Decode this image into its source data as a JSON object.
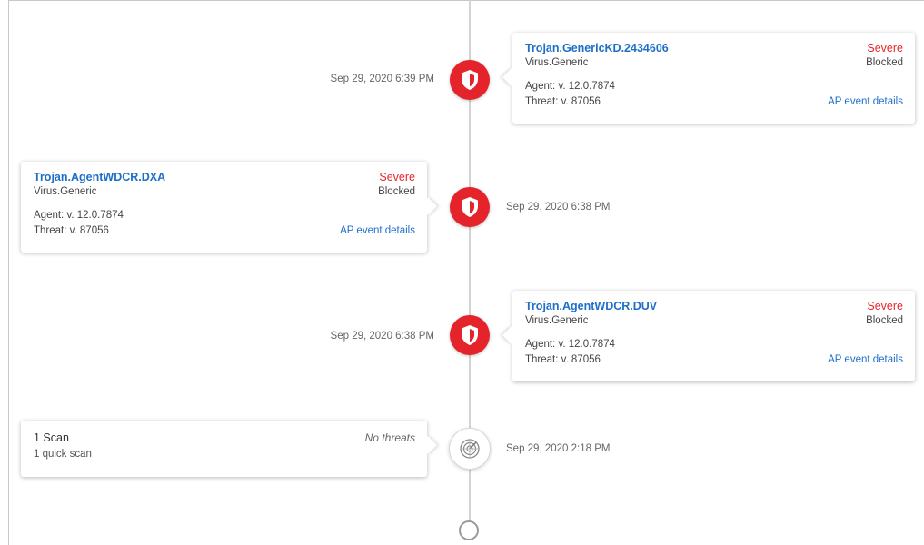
{
  "events": [
    {
      "threat_name": "Trojan.GenericKD.2434606",
      "severity": "Severe",
      "category": "Virus.Generic",
      "status": "Blocked",
      "agent": "Agent: v. 12.0.7874",
      "threat_version": "Threat: v. 87056",
      "details_label": "AP event details",
      "timestamp": "Sep 29, 2020 6:39 PM",
      "side": "right"
    },
    {
      "threat_name": "Trojan.AgentWDCR.DXA",
      "severity": "Severe",
      "category": "Virus.Generic",
      "status": "Blocked",
      "agent": "Agent: v. 12.0.7874",
      "threat_version": "Threat: v. 87056",
      "details_label": "AP event details",
      "timestamp": "Sep 29, 2020 6:38 PM",
      "side": "left"
    },
    {
      "threat_name": "Trojan.AgentWDCR.DUV",
      "severity": "Severe",
      "category": "Virus.Generic",
      "status": "Blocked",
      "agent": "Agent: v. 12.0.7874",
      "threat_version": "Threat: v. 87056",
      "details_label": "AP event details",
      "timestamp": "Sep 29, 2020 6:38 PM",
      "side": "right"
    }
  ],
  "scan_event": {
    "title": "1 Scan",
    "subtitle": "1 quick scan",
    "result": "No threats",
    "timestamp": "Sep 29, 2020 2:18 PM"
  },
  "icons": {
    "threat_node": "shield-icon",
    "scan_node": "radar-scan-icon",
    "end_node": "loading-ring-icon"
  },
  "colors": {
    "threat_red": "#e4232b",
    "link_blue": "#1e6fc8",
    "severe_red": "#e5272d"
  }
}
